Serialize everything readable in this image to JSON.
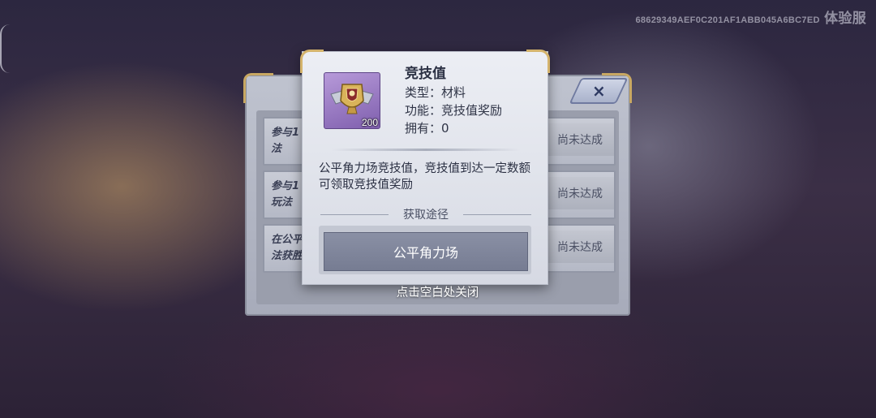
{
  "watermark": {
    "code": "68629349AEF0C201AF1ABB045A6BC7ED",
    "label": "体验服"
  },
  "quest_panel": {
    "close_icon": "×",
    "rows": [
      {
        "title": "参与1法",
        "status": "尚未达成"
      },
      {
        "title": "参与1玩法",
        "status": "尚未达成"
      },
      {
        "title": "在公平法获胜",
        "status": "尚未达成"
      }
    ]
  },
  "item_popup": {
    "icon": "trophy-emblem-icon",
    "count": "200",
    "name": "竞技值",
    "type_line": "类型：材料",
    "function_line": "功能：竞技值奖励",
    "owned_line": "拥有：0",
    "description": "公平角力场竞技值，竞技值到达一定数额可领取竞技值奖励",
    "source_header": "获取途径",
    "source_button": "公平角力场"
  },
  "close_hint": "点击空白处关闭",
  "colors": {
    "gold_trim": "#d4b36c",
    "item_bg": "#9a7cc6",
    "source_button": "#7f859b"
  }
}
